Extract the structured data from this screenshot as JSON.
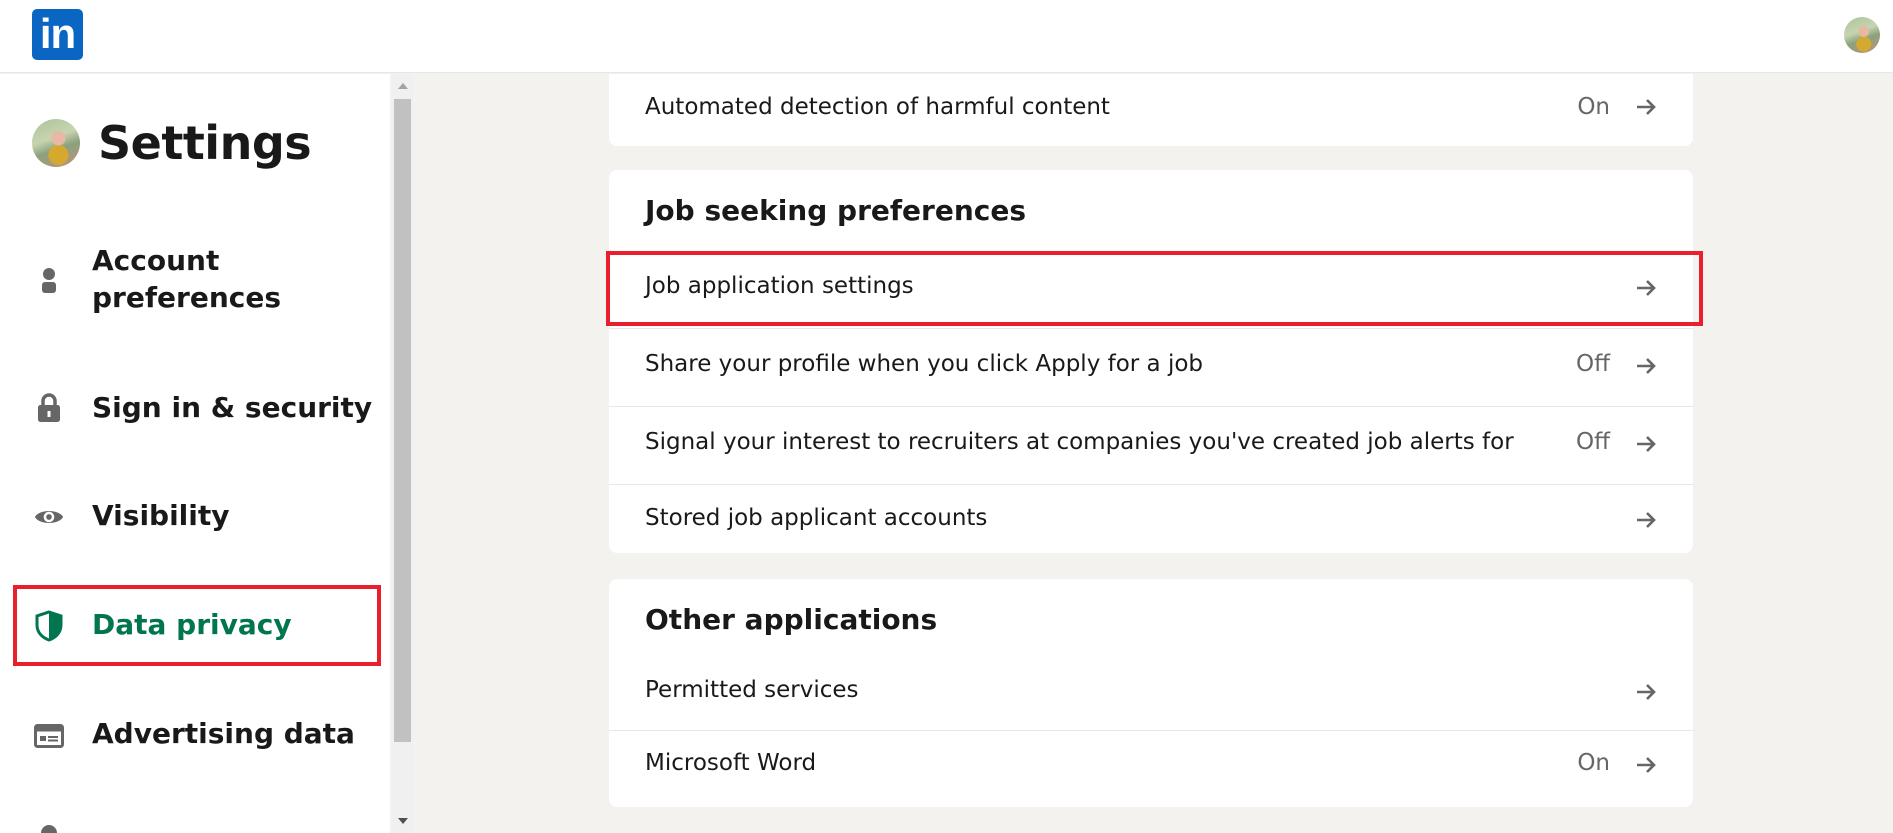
{
  "header": {
    "logo_text": "in",
    "logo_icon": "linkedin-logo",
    "avatar_icon": "user-avatar"
  },
  "sidebar": {
    "title": "Settings",
    "items": [
      {
        "label_line1": "Account",
        "label_line2": "preferences",
        "icon": "person-icon",
        "active": false
      },
      {
        "label": "Sign in & security",
        "icon": "lock-icon",
        "active": false
      },
      {
        "label": "Visibility",
        "icon": "eye-icon",
        "active": false
      },
      {
        "label": "Data privacy",
        "icon": "shield-icon",
        "active": true
      },
      {
        "label": "Advertising data",
        "icon": "ad-card-icon",
        "active": false
      }
    ]
  },
  "main": {
    "top_card": {
      "rows": [
        {
          "label": "Automated detection of harmful content",
          "status": "On"
        }
      ]
    },
    "job_card": {
      "heading": "Job seeking preferences",
      "rows": [
        {
          "label": "Job application settings",
          "status": ""
        },
        {
          "label": "Share your profile when you click Apply for a job",
          "status": "Off"
        },
        {
          "label": "Signal your interest to recruiters at companies you've created job alerts for",
          "status": "Off"
        },
        {
          "label": "Stored job applicant accounts",
          "status": ""
        }
      ]
    },
    "other_card": {
      "heading": "Other applications",
      "rows": [
        {
          "label": "Permitted services",
          "status": ""
        },
        {
          "label": "Microsoft Word",
          "status": "On"
        }
      ]
    }
  },
  "colors": {
    "brand_blue": "#0a66c2",
    "active_green": "#01754f",
    "highlight_red": "#e8202e",
    "page_bg": "#f3f2ef"
  }
}
